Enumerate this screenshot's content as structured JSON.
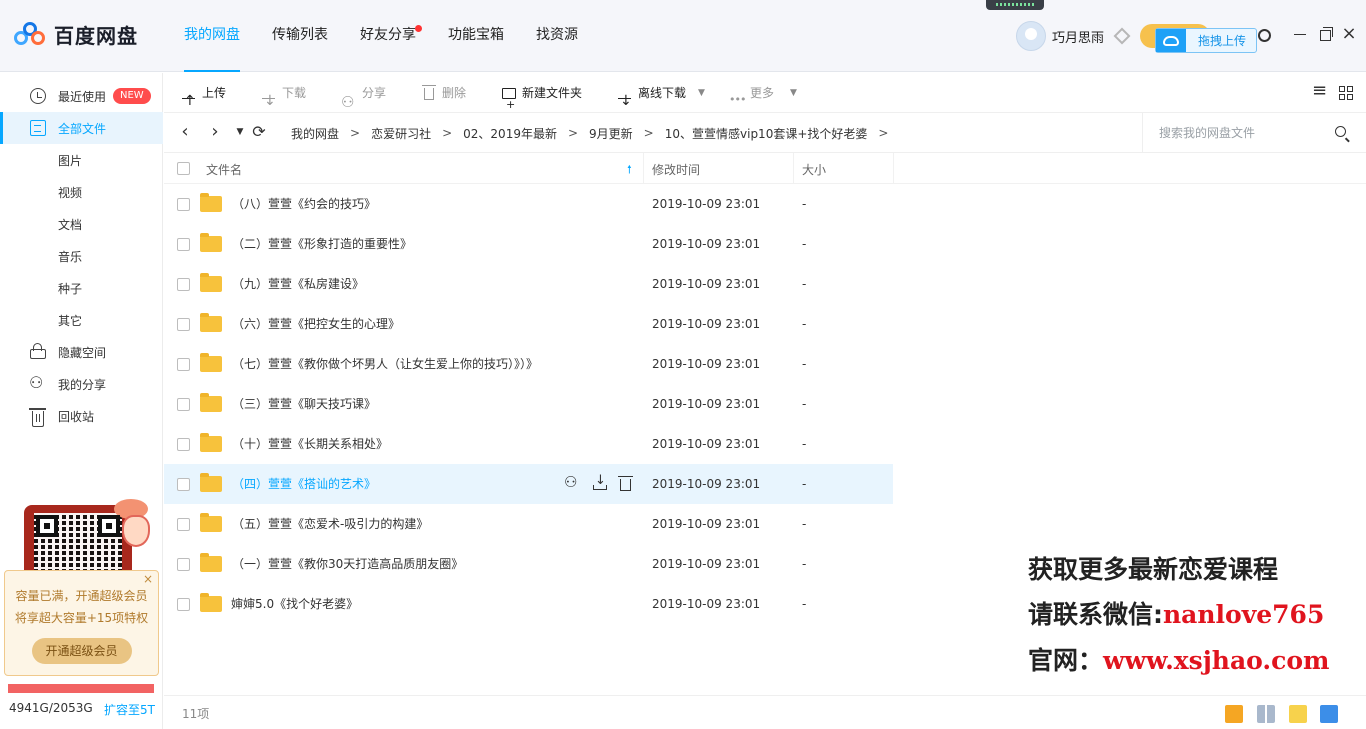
{
  "app": {
    "logo_text": "百度网盘"
  },
  "topnav": [
    {
      "label": "我的网盘",
      "active": true
    },
    {
      "label": "传输列表",
      "active": false
    },
    {
      "label": "好友分享",
      "active": false,
      "dot": true
    },
    {
      "label": "功能宝箱",
      "active": false
    },
    {
      "label": "找资源",
      "active": false
    }
  ],
  "user": {
    "name": "巧月思雨",
    "drag_upload_label": "拖拽上传"
  },
  "sidebar": {
    "items": [
      {
        "label": "最近使用",
        "badge": "NEW",
        "icon": "clock-icon"
      },
      {
        "label": "全部文件",
        "icon": "document-icon",
        "active": true
      },
      {
        "label": "图片"
      },
      {
        "label": "视频"
      },
      {
        "label": "文档"
      },
      {
        "label": "音乐"
      },
      {
        "label": "种子"
      },
      {
        "label": "其它"
      },
      {
        "label": "隐藏空间",
        "icon": "lock-icon"
      },
      {
        "label": "我的分享",
        "icon": "share-icon"
      },
      {
        "label": "回收站",
        "icon": "trash-icon"
      }
    ],
    "promo": {
      "line1": "容量已满，开通超级会员",
      "line2": "将享超大容量+15项特权",
      "button": "开通超级会员",
      "close": "×"
    },
    "quota": {
      "used_text": "4941G/2053G",
      "expand_text": "扩容至5T",
      "fill_fraction": 1.0,
      "color": "#f26363"
    }
  },
  "toolbar": {
    "upload": "上传",
    "download": "下载",
    "share": "分享",
    "delete": "删除",
    "new_folder": "新建文件夹",
    "offline_download": "离线下载",
    "more": "更多"
  },
  "breadcrumb": {
    "items": [
      "我的网盘",
      "恋爱研习社",
      "02、2019年最新",
      "9月更新",
      "10、萱萱情感vip10套课+找个好老婆"
    ],
    "separator": ">"
  },
  "search": {
    "placeholder": "搜索我的网盘文件"
  },
  "list": {
    "headers": {
      "name": "文件名",
      "modified": "修改时间",
      "size": "大小"
    },
    "rows": [
      {
        "name": "（八）萱萱《约会的技巧》",
        "modified": "2019-10-09 23:01",
        "size": "-"
      },
      {
        "name": "（二）萱萱《形象打造的重要性》",
        "modified": "2019-10-09 23:01",
        "size": "-"
      },
      {
        "name": "（九）萱萱《私房建设》",
        "modified": "2019-10-09 23:01",
        "size": "-"
      },
      {
        "name": "（六）萱萱《把控女生的心理》",
        "modified": "2019-10-09 23:01",
        "size": "-"
      },
      {
        "name": "（七）萱萱《教你做个坏男人（让女生爱上你的技巧）》）》",
        "modified": "2019-10-09 23:01",
        "size": "-"
      },
      {
        "name": "（三）萱萱《聊天技巧课》",
        "modified": "2019-10-09 23:01",
        "size": "-"
      },
      {
        "name": "（十）萱萱《长期关系相处》",
        "modified": "2019-10-09 23:01",
        "size": "-"
      },
      {
        "name": "（四）萱萱《搭讪的艺术》",
        "modified": "2019-10-09 23:01",
        "size": "-",
        "hover": true
      },
      {
        "name": "（五）萱萱《恋爱术-吸引力的构建》",
        "modified": "2019-10-09 23:01",
        "size": "-"
      },
      {
        "name": "（一）萱萱《教你30天打造高品质朋友圈》",
        "modified": "2019-10-09 23:01",
        "size": "-"
      },
      {
        "name": "婶婶5.0《找个好老婆》",
        "modified": "2019-10-09 23:01",
        "size": "-"
      }
    ]
  },
  "watermark": {
    "line1": "获取更多最新恋爱课程",
    "line2_label": "请联系微信:",
    "line2_value": "nanlove765",
    "line3_label": "官网：",
    "line3_value": "www.xsjhao.com"
  },
  "status": {
    "count": "11项"
  },
  "colors": {
    "accent": "#06a7ff",
    "folder": "#f7c23c",
    "new_badge": "#ff4c4c",
    "watermark_red": "#e0141e"
  }
}
